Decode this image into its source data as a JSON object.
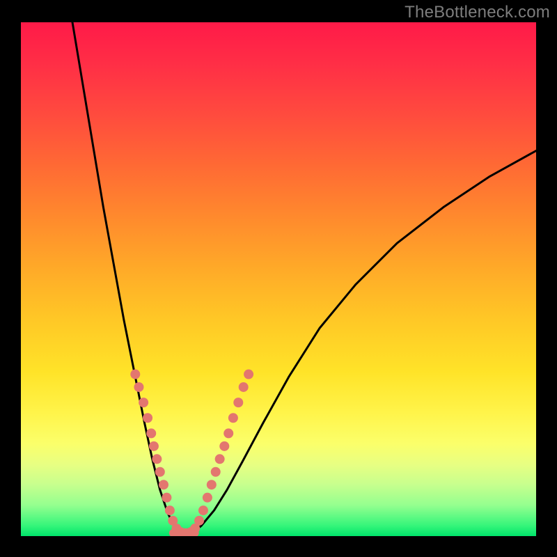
{
  "watermark": "TheBottleneck.com",
  "chart_data": {
    "type": "line",
    "title": "",
    "xlabel": "",
    "ylabel": "",
    "xlim": [
      0,
      100
    ],
    "ylim": [
      0,
      100
    ],
    "annotations": [],
    "series": [
      {
        "name": "left-curve",
        "x": [
          10,
          12,
          14,
          16,
          18,
          20,
          22,
          24,
          25.5,
          27,
          28.5,
          30,
          31
        ],
        "y": [
          100,
          88,
          76,
          64,
          53,
          42,
          32,
          22,
          15,
          9,
          4.5,
          1.5,
          0.5
        ],
        "stroke": "#000000"
      },
      {
        "name": "right-curve",
        "x": [
          33,
          35,
          37.5,
          40,
          43,
          47,
          52,
          58,
          65,
          73,
          82,
          91,
          100
        ],
        "y": [
          0.5,
          2,
          5,
          9,
          14.5,
          22,
          31,
          40.5,
          49,
          57,
          64,
          70,
          75
        ],
        "stroke": "#000000"
      },
      {
        "name": "valley-floor",
        "x": [
          29.5,
          30.2,
          31,
          32,
          33,
          33.8
        ],
        "y": [
          0.6,
          0.3,
          0.2,
          0.2,
          0.3,
          0.6
        ],
        "stroke": "#e3766f"
      }
    ],
    "marker_points": {
      "color": "#e3766f",
      "radius_px": 7,
      "points": [
        {
          "x": 22.2,
          "y": 31.5
        },
        {
          "x": 22.9,
          "y": 29.0
        },
        {
          "x": 23.8,
          "y": 26.0
        },
        {
          "x": 24.6,
          "y": 23.0
        },
        {
          "x": 25.3,
          "y": 20.0
        },
        {
          "x": 25.8,
          "y": 17.5
        },
        {
          "x": 26.4,
          "y": 15.0
        },
        {
          "x": 27.0,
          "y": 12.5
        },
        {
          "x": 27.7,
          "y": 10.0
        },
        {
          "x": 28.3,
          "y": 7.5
        },
        {
          "x": 28.9,
          "y": 5.0
        },
        {
          "x": 29.5,
          "y": 3.0
        },
        {
          "x": 30.2,
          "y": 1.5
        },
        {
          "x": 31.0,
          "y": 0.8
        },
        {
          "x": 32.0,
          "y": 0.6
        },
        {
          "x": 33.0,
          "y": 0.8
        },
        {
          "x": 33.8,
          "y": 1.5
        },
        {
          "x": 34.6,
          "y": 3.0
        },
        {
          "x": 35.4,
          "y": 5.0
        },
        {
          "x": 36.2,
          "y": 7.5
        },
        {
          "x": 37.0,
          "y": 10.0
        },
        {
          "x": 37.8,
          "y": 12.5
        },
        {
          "x": 38.6,
          "y": 15.0
        },
        {
          "x": 39.5,
          "y": 17.5
        },
        {
          "x": 40.3,
          "y": 20.0
        },
        {
          "x": 41.2,
          "y": 23.0
        },
        {
          "x": 42.2,
          "y": 26.0
        },
        {
          "x": 43.2,
          "y": 29.0
        },
        {
          "x": 44.2,
          "y": 31.5
        }
      ]
    },
    "gradient_stops": [
      {
        "pct": 0,
        "color": "#ff1a48"
      },
      {
        "pct": 18,
        "color": "#ff4b3e"
      },
      {
        "pct": 38,
        "color": "#ff8a2d"
      },
      {
        "pct": 58,
        "color": "#ffc826"
      },
      {
        "pct": 76,
        "color": "#fff44a"
      },
      {
        "pct": 90,
        "color": "#c7ff8e"
      },
      {
        "pct": 100,
        "color": "#00e46a"
      }
    ]
  }
}
